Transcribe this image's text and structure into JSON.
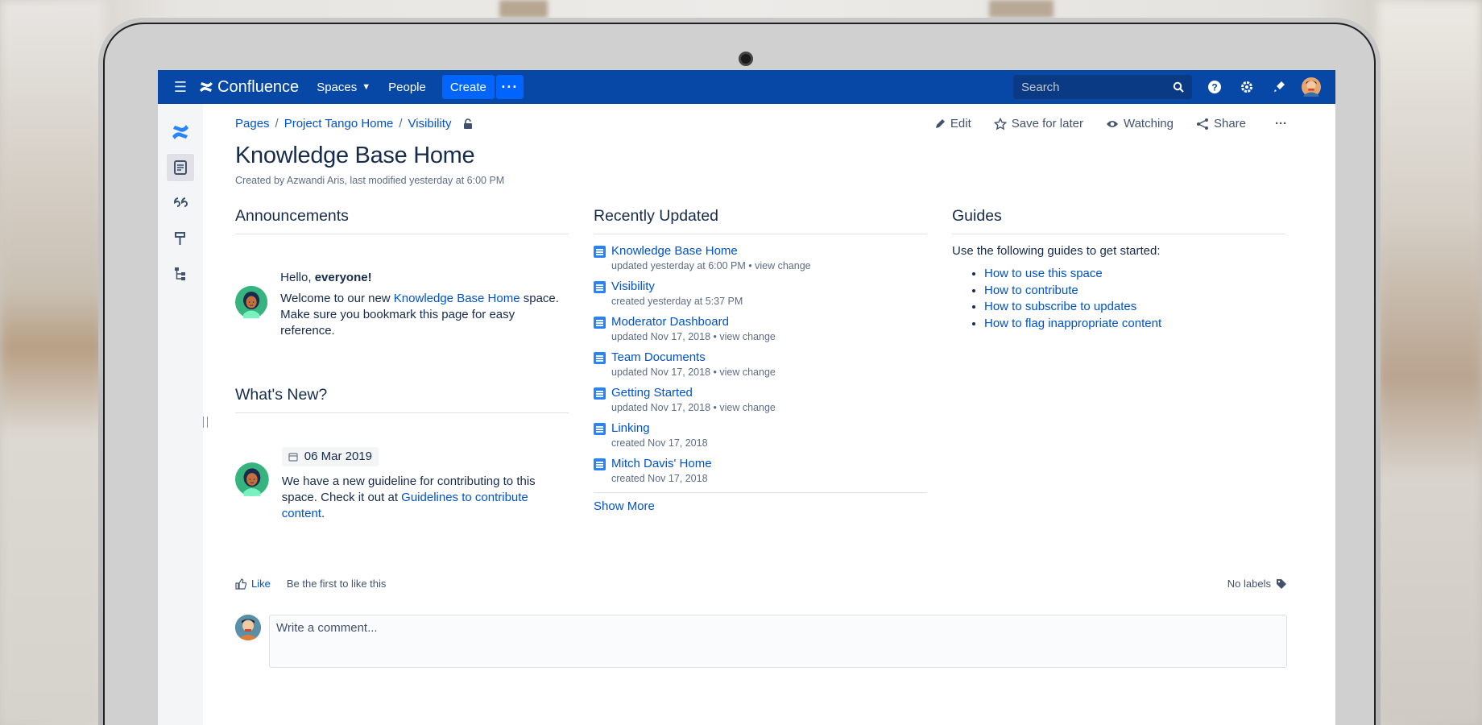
{
  "nav": {
    "product": "Confluence",
    "spaces": "Spaces",
    "people": "People",
    "create": "Create",
    "more": "···",
    "search_placeholder": "Search"
  },
  "breadcrumb": [
    "Pages",
    "Project Tango Home",
    "Visibility"
  ],
  "actions": {
    "edit": "Edit",
    "save": "Save for later",
    "watching": "Watching",
    "share": "Share",
    "more": "···"
  },
  "page": {
    "title": "Knowledge Base Home",
    "meta": "Created by Azwandi Aris, last modified yesterday at 6:00 PM"
  },
  "announcements": {
    "heading": "Announcements",
    "hello": "Hello, ",
    "everyone": "everyone!",
    "welcome_pre": "Welcome to our new ",
    "welcome_link": "Knowledge Base Home",
    "welcome_post": " space. Make sure you bookmark this page for easy reference."
  },
  "whats_new": {
    "heading": "What's New?",
    "date": "06 Mar 2019",
    "text_pre": "We have a new guideline for contributing to this space. Check it out at ",
    "link": "Guidelines to contribute content",
    "text_post": "."
  },
  "recently_updated": {
    "heading": "Recently Updated",
    "items": [
      {
        "title": "Knowledge Base Home",
        "sub": "updated yesterday at 6:00 PM",
        "change": "view change"
      },
      {
        "title": "Visibility",
        "sub": "created yesterday at 5:37 PM",
        "change": ""
      },
      {
        "title": "Moderator Dashboard",
        "sub": "updated Nov 17, 2018",
        "change": "view change"
      },
      {
        "title": "Team Documents",
        "sub": "updated Nov 17, 2018",
        "change": "view change"
      },
      {
        "title": "Getting Started",
        "sub": "updated Nov 17, 2018",
        "change": "view change"
      },
      {
        "title": "Linking",
        "sub": "created Nov 17, 2018",
        "change": ""
      },
      {
        "title": "Mitch Davis' Home",
        "sub": "created Nov 17, 2018",
        "change": ""
      }
    ],
    "show_more": "Show More"
  },
  "guides": {
    "heading": "Guides",
    "intro": "Use the following guides to get started:",
    "links": [
      "How to use this space",
      "How to contribute",
      "How to subscribe to updates",
      "How to flag inappropriate content"
    ]
  },
  "footer": {
    "like": "Like",
    "first": "Be the first to like this",
    "labels": "No labels",
    "comment_placeholder": "Write a comment..."
  },
  "colors": {
    "nav": "#0747a6",
    "create": "#0065ff",
    "link": "#0052cc"
  }
}
